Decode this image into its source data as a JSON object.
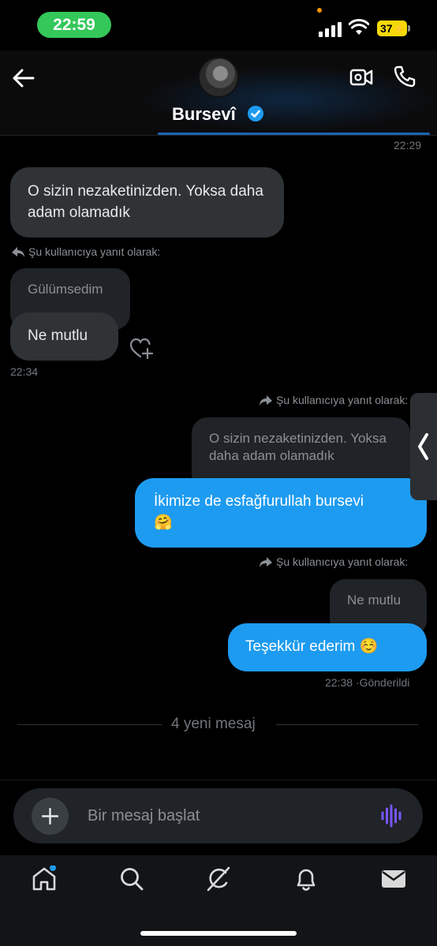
{
  "status_bar": {
    "time": "22:59",
    "battery": "37"
  },
  "header": {
    "contact_name": "Bursevî"
  },
  "messages": {
    "ts_top": "22:29",
    "in1_text": "O sizin nezaketinizden. Yoksa daha adam olamadık",
    "reply_label_in": "Şu kullanıcıya yanıt olarak:",
    "in_quoted": "Gülümsedim",
    "in2_text": "Ne mutlu",
    "ts_in2": "22:34",
    "reply_label_out1": "Şu kullanıcıya yanıt olarak:",
    "out1_quoted": "O sizin nezaketinizden. Yoksa daha adam olamadık",
    "out1_text": "İkimize de esfağfurullah bursevi",
    "out1_emoji": "🤗",
    "reply_label_out2": "Şu kullanıcıya yanıt olarak:",
    "out2_quoted": "Ne mutlu",
    "out2_text": "Teşekkür ederim",
    "out2_emoji": "☺️",
    "ts_out2": "22:38",
    "sent_status": "·Gönderildi"
  },
  "new_messages_divider": "4 yeni mesaj",
  "composer": {
    "placeholder": "Bir mesaj başlat"
  },
  "nav": [
    "home-icon",
    "search-icon",
    "grok-icon",
    "notifications-icon",
    "messages-icon"
  ],
  "colors": {
    "accent": "#1d9bf0",
    "incoming_bubble": "#2f3336",
    "status_green": "#34c759",
    "battery_yellow": "#f5d90a"
  }
}
